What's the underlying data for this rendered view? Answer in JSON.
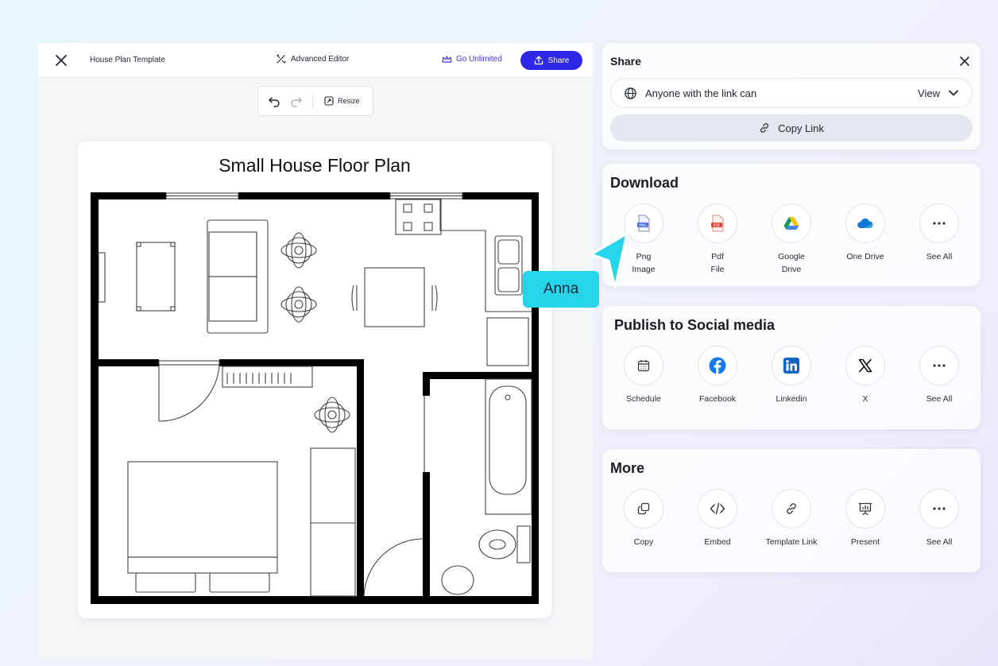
{
  "editor": {
    "doc_title": "House Plan Template",
    "advanced_editor": "Advanced Editor",
    "go_unlimited": "Go Unlimited",
    "share_label": "Share",
    "resize_label": "Resize",
    "plan_title": "Small House Floor Plan"
  },
  "share_panel": {
    "title": "Share",
    "access_text": "Anyone with the link can",
    "permission": "View",
    "copy_link": "Copy Link"
  },
  "download": {
    "title": "Download",
    "options": [
      {
        "label": "Png\nImage",
        "icon": "png-file-icon"
      },
      {
        "label": "Pdf\nFile",
        "icon": "pdf-file-icon"
      },
      {
        "label": "Google\nDrive",
        "icon": "google-drive-icon"
      },
      {
        "label": "One Drive",
        "icon": "onedrive-icon"
      },
      {
        "label": "See All",
        "icon": "more-icon"
      }
    ]
  },
  "social": {
    "title": "Publish to Social media",
    "options": [
      {
        "label": "Schedule",
        "icon": "calendar-icon"
      },
      {
        "label": "Facebook",
        "icon": "facebook-icon"
      },
      {
        "label": "Linkedin",
        "icon": "linkedin-icon"
      },
      {
        "label": "X",
        "icon": "x-icon"
      },
      {
        "label": "See All",
        "icon": "more-icon"
      }
    ]
  },
  "more": {
    "title": "More",
    "options": [
      {
        "label": "Copy",
        "icon": "copy-icon"
      },
      {
        "label": "Embed",
        "icon": "code-icon"
      },
      {
        "label": "Template Link",
        "icon": "link-icon"
      },
      {
        "label": "Present",
        "icon": "presentation-icon"
      },
      {
        "label": "See All",
        "icon": "more-icon"
      }
    ]
  },
  "collaborator": {
    "name": "Anna"
  },
  "colors": {
    "accent": "#2f27e6",
    "cursor": "#27d5ea",
    "facebook": "#1877f2",
    "linkedin": "#0a66c2"
  }
}
